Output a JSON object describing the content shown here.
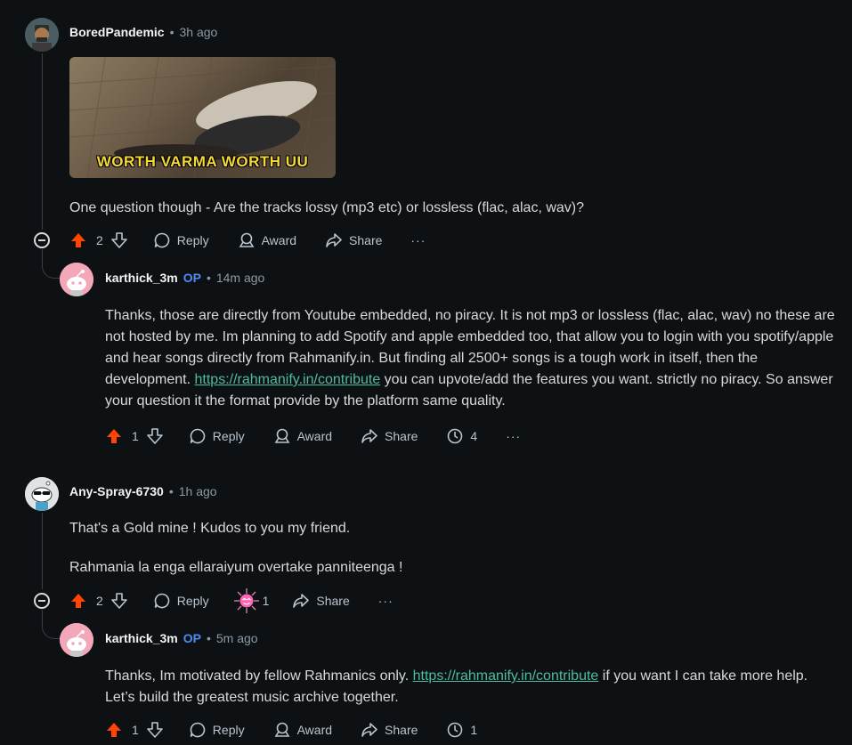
{
  "comments": [
    {
      "author": "BoredPandemic",
      "time": "3h ago",
      "media_caption": "WORTH VARMA WORTH UU",
      "body": "One question though - Are the tracks lossy (mp3 etc) or lossless (flac, alac, wav)?",
      "votes": "2",
      "reply_label": "Reply",
      "award_label": "Award",
      "share_label": "Share",
      "more_label": "···"
    },
    {
      "author": "karthick_3m",
      "op": "OP",
      "time": "14m ago",
      "body_part1": "Thanks, those are directly from Youtube embedded, no piracy. It is not mp3 or lossless (flac, alac, wav) no these are not hosted by me. Im planning to add Spotify and apple embedded too, that allow you to login with you spotify/apple and hear songs directly from Rahmanify.in. But finding all 2500+ songs is a tough work in itself, then the development. ",
      "link": "https://rahmanify.in/contribute",
      "body_part2": " you can upvote/add the features you want. strictly no piracy. So answer your question it the format provide by the platform same quality.",
      "votes": "1",
      "reply_label": "Reply",
      "award_label": "Award",
      "share_label": "Share",
      "insights": "4",
      "more_label": "···"
    },
    {
      "author": "Any-Spray-6730",
      "time": "1h ago",
      "body_line1": "That's a Gold mine ! Kudos to you my friend.",
      "body_line2": "Rahmania la enga ellaraiyum overtake panniteenga !",
      "votes": "2",
      "reply_label": "Reply",
      "award_count": "1",
      "share_label": "Share",
      "more_label": "···"
    },
    {
      "author": "karthick_3m",
      "op": "OP",
      "time": "5m ago",
      "body_part1": "Thanks, Im motivated by fellow Rahmanics only. ",
      "link": "https://rahmanify.in/contribute",
      "body_part2": " if you want I can take more help. Let’s build the greatest music archive together.",
      "votes": "1",
      "reply_label": "Reply",
      "award_label": "Award",
      "share_label": "Share",
      "insights": "1",
      "more_label": "···"
    }
  ],
  "separator": "•",
  "colors": {
    "upvote": "#ff4500",
    "op": "#4b8cf7",
    "link": "#4fbc9e",
    "background": "#0e1113"
  }
}
